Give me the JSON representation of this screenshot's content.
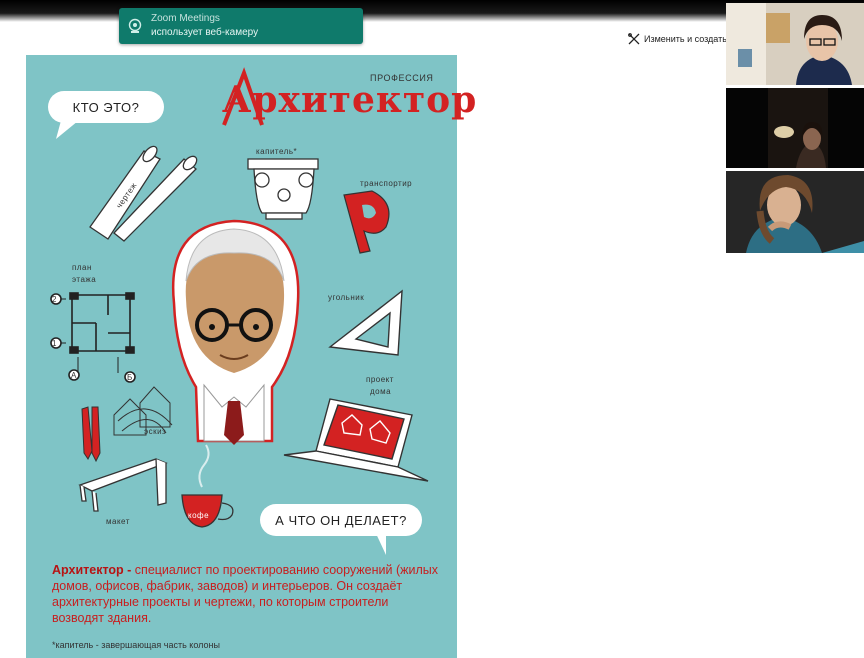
{
  "zoom": {
    "notification_title": "Zoom Meetings",
    "notification_text": "использует веб-камеру",
    "edit_button_label": "Изменить и создать"
  },
  "poster": {
    "kicker": "ПРОФЕССИЯ",
    "title": "Архитектор",
    "bubble_question": "КТО ЭТО?",
    "bubble_answer": "А ЧТО ОН ДЕЛАЕТ?",
    "labels": {
      "capital": "капитель*",
      "protractor": "транспортир",
      "drawing": "чертеж",
      "floor_plan_1": "план",
      "floor_plan_2": "этажа",
      "square": "угольник",
      "house_project_1": "проект",
      "house_project_2": "дома",
      "sketch": "эскиз",
      "model": "макет",
      "coffee": "кофе",
      "axis_1": "1",
      "axis_2": "2",
      "axis_a": "А",
      "axis_b": "Б"
    },
    "description_term": "Архитектор -",
    "description_text": " специалист по проектированию сооружений (жилых домов, офисов, фабрик, заводов) и интерьеров. Он создаёт архитектурные проекты и чертежи, по которым строители возводят здания.",
    "footnote": "*капитель - завершающая часть колоны"
  }
}
